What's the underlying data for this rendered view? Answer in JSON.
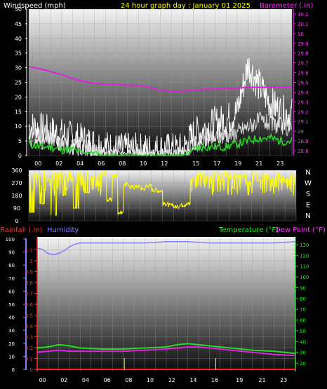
{
  "header": {
    "windspeed_label": "Windspeed (mph)",
    "title": "24 hour graph day : January 01 2025",
    "barometer_label": "Barometer (.in)"
  },
  "colors": {
    "background": "#000000",
    "wind": "#ffffff",
    "gust": "#ffffff",
    "wind_avg": "#22dd22",
    "barometer": "#dd22dd",
    "direction": "#ffff00",
    "rain": "#ff2222",
    "humidity": "#8080ff",
    "temperature": "#22dd22",
    "dewpoint": "#dd22dd",
    "header_text": "#ffff00",
    "axis_text": "#ffffff"
  },
  "chart_data": [
    {
      "type": "line",
      "name": "wind-barometer",
      "x_ticks": [
        "00",
        "02",
        "04",
        "06",
        "08",
        "10",
        "12",
        "15",
        "17",
        "19",
        "21",
        "23"
      ],
      "y_left": {
        "label": "Windspeed (mph)",
        "lim": [
          0,
          50
        ],
        "ticks": [
          "0",
          "5",
          "10",
          "15",
          "20",
          "25",
          "30",
          "35",
          "40",
          "45",
          "50"
        ]
      },
      "y_right": {
        "label": "Barometer (.in)",
        "lim": [
          28.75,
          30.25
        ],
        "ticks": [
          "28.8",
          "28.9",
          "29",
          "29.1",
          "29.2",
          "29.3",
          "29.4",
          "29.5",
          "29.6",
          "29.7",
          "29.8",
          "29.9",
          "30",
          "30.1",
          "30.2"
        ]
      },
      "grid": true,
      "series": [
        {
          "name": "barometer",
          "axis": "right",
          "hours": [
            0,
            1,
            2,
            3,
            4,
            5,
            6,
            7,
            8,
            9,
            10,
            11,
            12,
            13,
            14,
            15,
            16,
            17,
            18,
            19,
            20,
            21,
            22,
            23,
            24
          ],
          "values": [
            29.66,
            29.64,
            29.61,
            29.58,
            29.54,
            29.51,
            29.49,
            29.48,
            29.48,
            29.47,
            29.47,
            29.45,
            29.42,
            29.41,
            29.41,
            29.42,
            29.43,
            29.43,
            29.44,
            29.44,
            29.45,
            29.45,
            29.45,
            29.45,
            29.45
          ]
        },
        {
          "name": "gust",
          "axis": "left",
          "hours": [
            0,
            1,
            2,
            3,
            4,
            5,
            6,
            7,
            8,
            9,
            10,
            11,
            12,
            13,
            14,
            15,
            16,
            17,
            18,
            19,
            20,
            21,
            22,
            23,
            24
          ],
          "values": [
            10,
            9,
            8,
            7,
            6,
            5,
            4,
            3,
            2,
            2,
            2,
            2,
            2,
            2,
            2,
            7,
            9,
            11,
            12,
            15,
            31,
            24,
            18,
            15,
            14
          ]
        },
        {
          "name": "wind",
          "axis": "left",
          "hours": [
            0,
            1,
            2,
            3,
            4,
            5,
            6,
            7,
            8,
            9,
            10,
            11,
            12,
            13,
            14,
            15,
            16,
            17,
            18,
            19,
            20,
            21,
            22,
            23,
            24
          ],
          "values": [
            6,
            5,
            5,
            4,
            3,
            3,
            2,
            1,
            1,
            1,
            1,
            1,
            1,
            1,
            1,
            4,
            5,
            6,
            7,
            8,
            10,
            12,
            11,
            10,
            9
          ]
        },
        {
          "name": "wind_avg",
          "axis": "left",
          "hours": [
            0,
            1,
            2,
            3,
            4,
            5,
            6,
            7,
            8,
            9,
            10,
            11,
            12,
            13,
            14,
            15,
            16,
            17,
            18,
            19,
            20,
            21,
            22,
            23,
            24
          ],
          "values": [
            4,
            3,
            3,
            2,
            2,
            1,
            1,
            0,
            0,
            0,
            0,
            0,
            0,
            0,
            0,
            2,
            3,
            3,
            3,
            4,
            5,
            6,
            6,
            5,
            5
          ]
        }
      ]
    },
    {
      "type": "scatter",
      "name": "wind-direction",
      "y_left": {
        "lim": [
          0,
          360
        ],
        "ticks": [
          "0",
          "90",
          "180",
          "270",
          "360"
        ]
      },
      "compass": [
        "N",
        "W",
        "S",
        "E",
        "N"
      ],
      "grid": true,
      "series": [
        {
          "name": "direction",
          "hours": [
            0,
            0.5,
            1,
            1.5,
            2,
            2.5,
            3,
            3.5,
            4,
            4.5,
            5,
            5.5,
            6,
            6.5,
            7,
            7.5,
            8,
            8.5,
            9,
            9.5,
            10,
            10.5,
            11,
            11.5,
            12,
            12.5,
            13,
            13.5,
            14,
            14.5,
            15,
            15.5,
            16,
            16.5,
            17,
            17.5,
            18,
            18.5,
            19,
            19.5,
            20,
            20.5,
            21,
            21.5,
            22,
            22.5,
            23,
            23.5,
            24
          ],
          "values": [
            60,
            330,
            120,
            300,
            40,
            340,
            180,
            310,
            90,
            330,
            200,
            300,
            250,
            340,
            150,
            320,
            60,
            260,
            240,
            245,
            230,
            250,
            220,
            215,
            120,
            110,
            100,
            115,
            120,
            300,
            330,
            310,
            320,
            340,
            290,
            320,
            300,
            330,
            320,
            280,
            340,
            290,
            330,
            300,
            320,
            310,
            300,
            320,
            310
          ]
        }
      ]
    },
    {
      "type": "line",
      "name": "rain-humidity-temperature",
      "x_ticks": [
        "00",
        "02",
        "04",
        "06",
        "08",
        "10",
        "12",
        "14",
        "16",
        "19",
        "21",
        "23"
      ],
      "y_far_left": {
        "label": "Humidity",
        "lim": [
          0,
          100
        ],
        "ticks": [
          "0",
          "10",
          "20",
          "30",
          "40",
          "50",
          "60",
          "70",
          "80",
          "90",
          "100"
        ]
      },
      "y_left": {
        "label": "Rainfall (.in)",
        "lim": [
          0,
          1.2
        ],
        "ticks": [
          "0",
          "0.1",
          "0.2",
          "0.3",
          "0.4",
          "0.5",
          "0.6",
          "0.7",
          "0.8",
          "0.9",
          "1",
          "1.1"
        ]
      },
      "y_right": {
        "label": "Temperature (°F)",
        "lim": [
          10,
          135
        ],
        "ticks": [
          "10",
          "20",
          "30",
          "40",
          "50",
          "60",
          "70",
          "80",
          "90",
          "100",
          "110",
          "120",
          "130"
        ]
      },
      "dewpoint_label": "Dew Point (°F)",
      "grid": true,
      "series": [
        {
          "name": "humidity",
          "axis": "far_left",
          "hours": [
            0,
            0.5,
            1,
            1.5,
            2,
            2.5,
            3,
            3.5,
            4,
            6,
            8,
            10,
            12,
            14,
            16,
            18,
            20,
            22,
            24
          ],
          "values": [
            93,
            92,
            89,
            88,
            89,
            91,
            94,
            96,
            97,
            97,
            97,
            97,
            98,
            98,
            97,
            97,
            97,
            97,
            98
          ]
        },
        {
          "name": "temperature",
          "axis": "right",
          "hours": [
            0,
            1,
            2,
            3,
            4,
            6,
            8,
            10,
            12,
            13,
            14,
            15,
            16,
            17,
            18,
            20,
            22,
            24
          ],
          "values": [
            34,
            35,
            37,
            36,
            34,
            33,
            33,
            34,
            35,
            37,
            38,
            37,
            36,
            35,
            34,
            32,
            31,
            29
          ]
        },
        {
          "name": "dewpoint",
          "axis": "right",
          "hours": [
            0,
            1,
            2,
            3,
            4,
            6,
            8,
            10,
            12,
            13,
            14,
            15,
            16,
            17,
            18,
            20,
            22,
            24
          ],
          "values": [
            30,
            31,
            32,
            31,
            31,
            31,
            31,
            32,
            33,
            34,
            35,
            35,
            34,
            33,
            32,
            30,
            28,
            27
          ]
        },
        {
          "name": "rain",
          "axis": "left",
          "hours": [
            0,
            24
          ],
          "values": [
            0,
            0
          ]
        }
      ],
      "spikes_hours": [
        8.1,
        16.6
      ]
    }
  ],
  "panel3_labels": {
    "rain": "Rainfall (.in)",
    "humidity": "Humidity",
    "temperature": "Temperature (°F)",
    "dewpoint": "Dew Point (°F)"
  }
}
